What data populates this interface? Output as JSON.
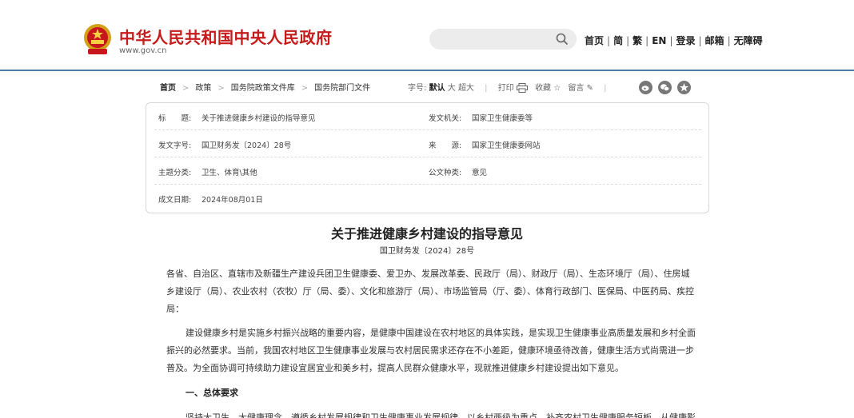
{
  "header": {
    "site_title": "中华人民共和国中央人民政府",
    "site_url": "www.gov.cn",
    "search_placeholder": "",
    "nav": [
      "首页",
      "简",
      "繁",
      "EN",
      "登录",
      "邮箱",
      "无障碍"
    ]
  },
  "breadcrumb": [
    "首页",
    "政策",
    "国务院政策文件库",
    "国务院部门文件"
  ],
  "tools": {
    "font_size_label": "字号:",
    "font_sizes": [
      "默认",
      "大",
      "超大"
    ],
    "selected_font_size": "默认",
    "print": "打印",
    "favorite": "收藏",
    "comment": "留言"
  },
  "share_icons": [
    "weibo-icon",
    "wechat-icon",
    "qzone-icon"
  ],
  "info": {
    "title_label": "标　　题:",
    "title_value": "关于推进健康乡村建设的指导意见",
    "issuer_label": "发文机关:",
    "issuer_value": "国家卫生健康委等",
    "doc_no_label": "发文字号:",
    "doc_no_value": "国卫财务发〔2024〕28号",
    "source_label": "来　　源:",
    "source_value": "国家卫生健康委网站",
    "category_label": "主题分类:",
    "category_value": "卫生、体育\\其他",
    "type_label": "公文种类:",
    "type_value": "意见",
    "date_label": "成文日期:",
    "date_value": "2024年08月01日"
  },
  "article": {
    "title": "关于推进健康乡村建设的指导意见",
    "doc_number": "国卫财务发〔2024〕28号",
    "p1": "各省、自治区、直辖市及新疆生产建设兵团卫生健康委、爱卫办、发展改革委、民政厅（局）、财政厅（局）、生态环境厅（局）、住房城乡建设厅（局）、农业农村（农牧）厅（局、委）、文化和旅游厅（局）、市场监管局（厅、委）、体育行政部门、医保局、中医药局、疾控局：",
    "p2": "建设健康乡村是实施乡村振兴战略的重要内容，是健康中国建设在农村地区的具体实践，是实现卫生健康事业高质量发展和乡村全面振兴的必然要求。当前，我国农村地区卫生健康事业发展与农村居民需求还存在不小差距，健康环境亟待改善，健康生活方式尚需进一步普及。为全面协调可持续助力建设宜居宜业和美乡村，提高人民群众健康水平，现就推进健康乡村建设提出如下意见。",
    "section1": "一、总体要求",
    "p3": "坚持大卫生、大健康理念，遵循乡村发展规律和卫生健康事业发展规律，以乡村两级为重点，补齐农村卫生健康服务短板，从健康影"
  }
}
